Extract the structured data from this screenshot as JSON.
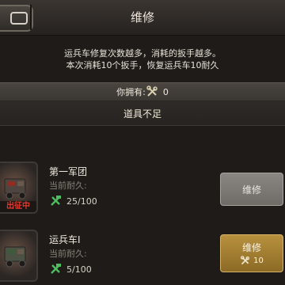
{
  "header": {
    "title": "维修"
  },
  "description": {
    "line1": "运兵车修复次数越多，消耗的扳手越多。",
    "line2": "本次消耗10个扳手，恢复运兵车10耐久"
  },
  "owned": {
    "label": "你拥有:",
    "count": "0"
  },
  "notice": "道具不足",
  "units": [
    {
      "name": "第一军团",
      "durability_label": "当前耐久:",
      "durability": "25/100",
      "status_badge": "出征中",
      "button_label": "维修"
    },
    {
      "name": "运兵车I",
      "durability_label": "当前耐久:",
      "durability": "5/100",
      "button_label": "维修",
      "cost": "10"
    }
  ],
  "colors": {
    "deploy_badge": "#e23a2e",
    "gold_button": "#b8913e",
    "disabled_button": "#8a8682"
  }
}
